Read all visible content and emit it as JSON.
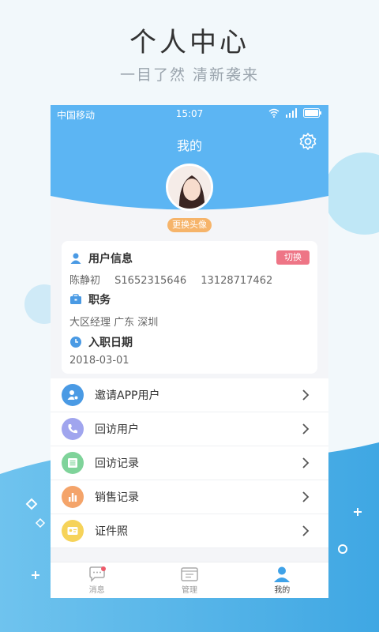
{
  "promo": {
    "title": "个人中心",
    "subtitle": "一目了然  清新袭来"
  },
  "status": {
    "carrier": "中国移动",
    "time": "15:07"
  },
  "nav": {
    "title": "我的"
  },
  "avatar_badge": "更换头像",
  "user_info": {
    "section_title": "用户信息",
    "switch_label": "切换",
    "name": "陈静初",
    "id": "S1652315646",
    "phone": "13128717462",
    "role_title": "职务",
    "role_value": "大区经理 广东 深圳",
    "date_title": "入职日期",
    "date_value": "2018-03-01"
  },
  "menu": [
    {
      "label": "邀请APP用户",
      "icon": "invite-user-icon",
      "color": "#4a9ae4"
    },
    {
      "label": "回访用户",
      "icon": "phone-icon",
      "color": "#a0a5ee"
    },
    {
      "label": "回访记录",
      "icon": "list-icon",
      "color": "#7fd39a"
    },
    {
      "label": "销售记录",
      "icon": "chart-icon",
      "color": "#f4a46a"
    },
    {
      "label": "证件照",
      "icon": "id-card-icon",
      "color": "#f6d35a"
    }
  ],
  "tabs": [
    {
      "label": "消息",
      "icon": "chat-icon"
    },
    {
      "label": "管理",
      "icon": "folder-icon"
    },
    {
      "label": "我的",
      "icon": "person-icon"
    }
  ],
  "colors": {
    "primary": "#5cb5f3",
    "accent_orange": "#f6b46a",
    "switch_red": "#ee7586"
  }
}
